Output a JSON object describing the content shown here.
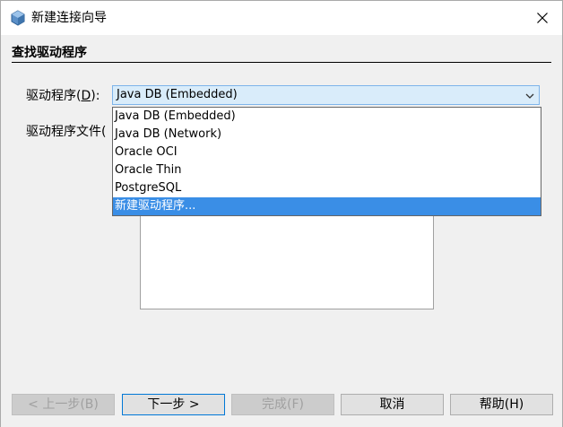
{
  "window": {
    "title": "新建连接向导"
  },
  "panel": {
    "heading": "查找驱动程序"
  },
  "form": {
    "driver_label_prefix": "驱动程序(",
    "driver_label_mnemonic": "D",
    "driver_label_suffix": "):",
    "driver_files_label": "驱动程序文件(",
    "driver_selected": "Java DB (Embedded)"
  },
  "dropdown": {
    "options": [
      "Java DB (Embedded)",
      "Java DB (Network)",
      "Oracle OCI",
      "Oracle Thin",
      "PostgreSQL",
      "新建驱动程序..."
    ],
    "highlighted_index": 5
  },
  "buttons": {
    "back": "< 上一步(B)",
    "next": "下一步 >",
    "finish": "完成(F)",
    "cancel": "取消",
    "help": "帮助(H)"
  },
  "colors": {
    "selection": "#3a8ee6",
    "combo_bg": "#d9ecfa",
    "accent_border": "#0078d7"
  },
  "icons": {
    "app": "netbeans-cube-icon",
    "close": "close-icon",
    "combo_arrow": "chevron-down-icon"
  }
}
